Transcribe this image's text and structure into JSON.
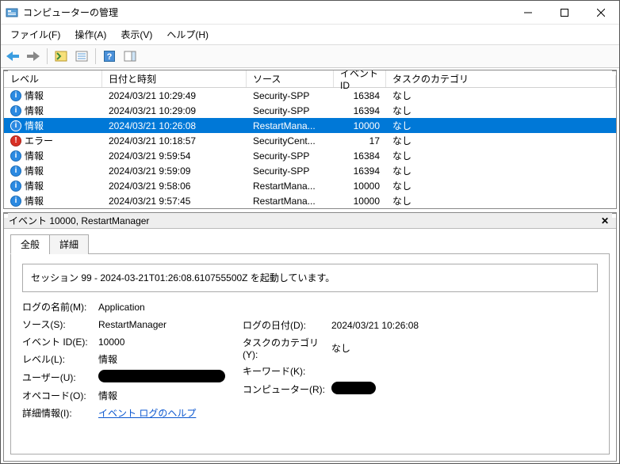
{
  "window": {
    "title": "コンピューターの管理"
  },
  "menu": {
    "file": "ファイル(F)",
    "action": "操作(A)",
    "view": "表示(V)",
    "help": "ヘルプ(H)"
  },
  "columns": {
    "level": "レベル",
    "date": "日付と時刻",
    "source": "ソース",
    "id": "イベント ID",
    "category": "タスクのカテゴリ"
  },
  "rows": [
    {
      "level": "情報",
      "icon": "info",
      "date": "2024/03/21 10:29:49",
      "source": "Security-SPP",
      "id": "16384",
      "category": "なし",
      "selected": false
    },
    {
      "level": "情報",
      "icon": "info",
      "date": "2024/03/21 10:29:09",
      "source": "Security-SPP",
      "id": "16394",
      "category": "なし",
      "selected": false
    },
    {
      "level": "情報",
      "icon": "info",
      "date": "2024/03/21 10:26:08",
      "source": "RestartMana...",
      "id": "10000",
      "category": "なし",
      "selected": true
    },
    {
      "level": "エラー",
      "icon": "error",
      "date": "2024/03/21 10:18:57",
      "source": "SecurityCent...",
      "id": "17",
      "category": "なし",
      "selected": false
    },
    {
      "level": "情報",
      "icon": "info",
      "date": "2024/03/21 9:59:54",
      "source": "Security-SPP",
      "id": "16384",
      "category": "なし",
      "selected": false
    },
    {
      "level": "情報",
      "icon": "info",
      "date": "2024/03/21 9:59:09",
      "source": "Security-SPP",
      "id": "16394",
      "category": "なし",
      "selected": false
    },
    {
      "level": "情報",
      "icon": "info",
      "date": "2024/03/21 9:58:06",
      "source": "RestartMana...",
      "id": "10000",
      "category": "なし",
      "selected": false
    },
    {
      "level": "情報",
      "icon": "info",
      "date": "2024/03/21 9:57:45",
      "source": "RestartMana...",
      "id": "10000",
      "category": "なし",
      "selected": false
    }
  ],
  "detail": {
    "header": "イベント 10000, RestartManager",
    "tabs": {
      "general": "全般",
      "details": "詳細"
    },
    "message": "セッション 99 - 2024-03-21T01:26:08.610755500Z を起動しています。",
    "labels": {
      "logName": "ログの名前(M):",
      "source": "ソース(S):",
      "eventId": "イベント ID(E):",
      "level": "レベル(L):",
      "user": "ユーザー(U):",
      "opcode": "オペコード(O):",
      "moreInfo": "詳細情報(I):",
      "logged": "ログの日付(D):",
      "category": "タスクのカテゴリ(Y):",
      "keywords": "キーワード(K):",
      "computer": "コンピューター(R):"
    },
    "values": {
      "logName": "Application",
      "source": "RestartManager",
      "eventId": "10000",
      "level": "情報",
      "opcode": "情報",
      "moreInfo": "イベント ログのヘルプ",
      "logged": "2024/03/21 10:26:08",
      "category": "なし",
      "keywords": ""
    }
  }
}
